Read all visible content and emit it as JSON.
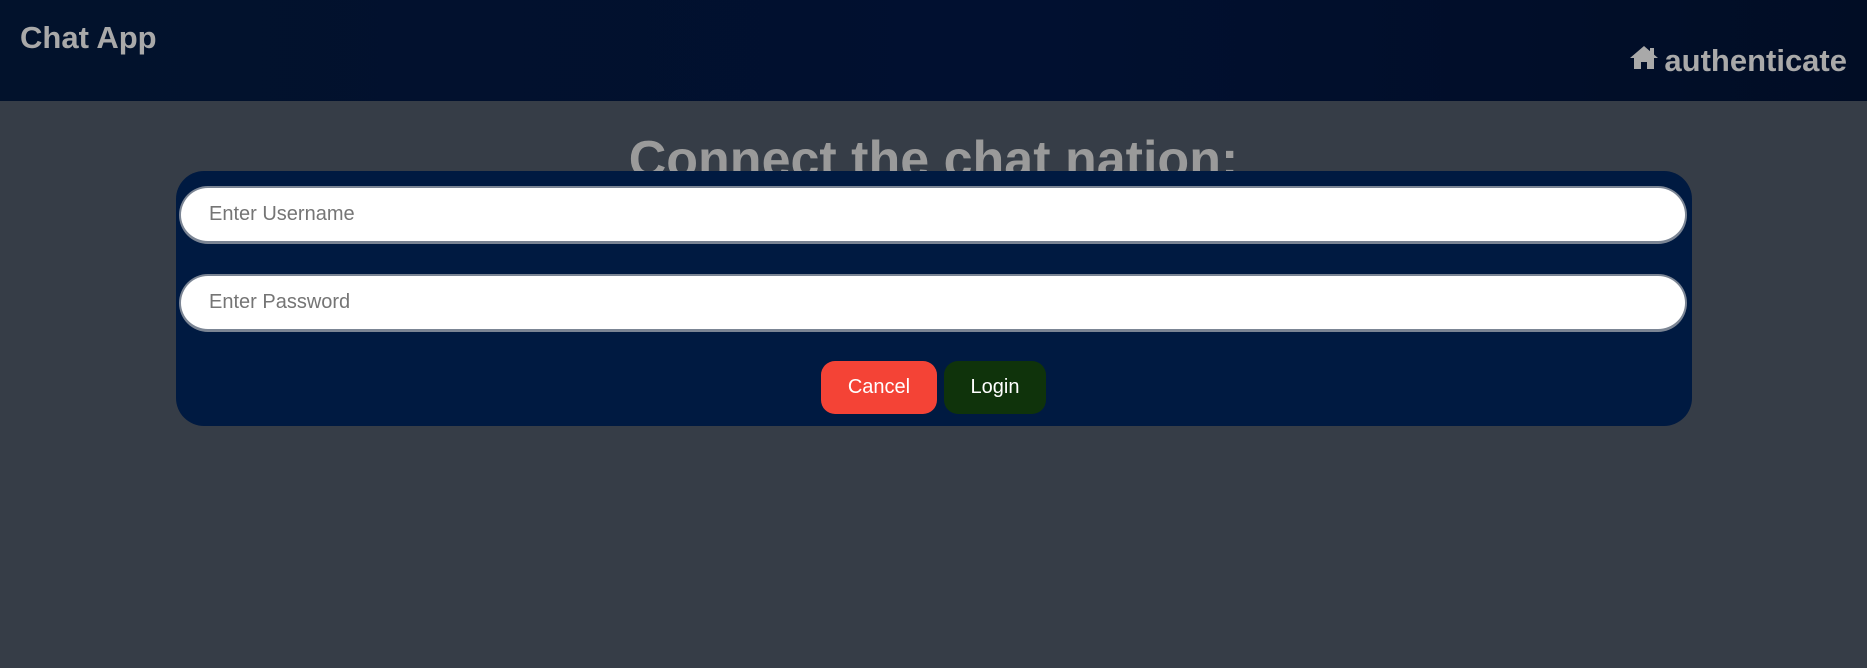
{
  "header": {
    "app_title": "Chat App",
    "nav_link_label": "authenticate",
    "nav_icon": "home-icon",
    "background_color": "#011030"
  },
  "main": {
    "heading": "Connect the chat nation:"
  },
  "login_form": {
    "username_placeholder": "Enter Username",
    "username_value": "",
    "password_placeholder": "Enter Password",
    "password_value": "",
    "cancel_label": "Cancel",
    "login_label": "Login",
    "cancel_color": "#f44336",
    "login_color": "#0f330b",
    "panel_color": "#001a41"
  }
}
